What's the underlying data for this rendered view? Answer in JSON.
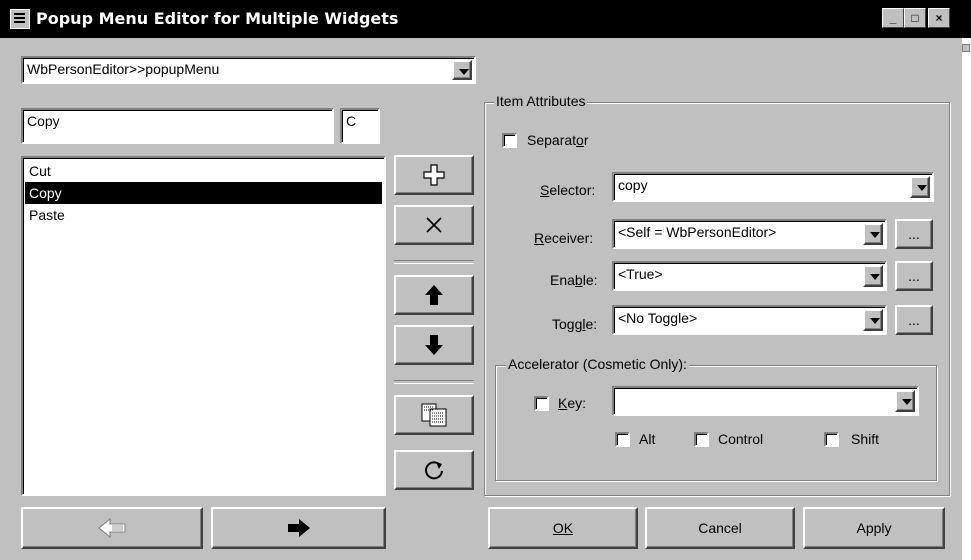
{
  "window": {
    "title": "Popup Menu Editor for Multiple Widgets",
    "controls": [
      "_",
      "□",
      "×"
    ]
  },
  "menu_selector": {
    "value": "WbPersonEditor>>popupMenu"
  },
  "item_name": {
    "value": "Copy"
  },
  "mnemonic": {
    "value": "C"
  },
  "menu_items": [
    {
      "label": "Cut",
      "selected": false
    },
    {
      "label": "Copy",
      "selected": true
    },
    {
      "label": "Paste",
      "selected": false
    }
  ],
  "tool_buttons": {
    "add": "plus-icon",
    "delete": "x-icon",
    "up": "arrow-up-icon",
    "down": "arrow-down-icon",
    "submenu": "submenu-icon",
    "refresh": "refresh-icon"
  },
  "item_attributes": {
    "group_label": "Item Attributes",
    "separator_label": "Separator",
    "separator_checked": false,
    "selector": {
      "label": "Selector:",
      "value": "copy"
    },
    "receiver": {
      "label": "Receiver:",
      "value": "<Self = WbPersonEditor>"
    },
    "enable": {
      "label": "Enable:",
      "value": "<True>"
    },
    "toggle": {
      "label": "Toggle:",
      "value": "<No Toggle>"
    },
    "ellipsis": "..."
  },
  "accelerator": {
    "group_label": "Accelerator (Cosmetic Only):",
    "key_label": "Key:",
    "key_value": "",
    "alt_label": "Alt",
    "control_label": "Control",
    "shift_label": "Shift"
  },
  "bottom": {
    "back": "arrow-left-icon",
    "forward": "arrow-right-icon",
    "ok": "OK",
    "cancel": "Cancel",
    "apply": "Apply"
  }
}
